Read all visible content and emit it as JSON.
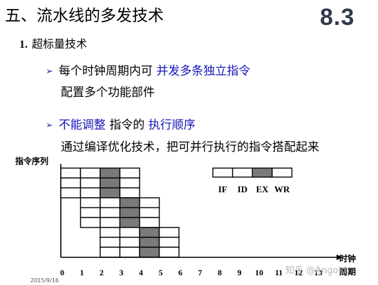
{
  "slide": {
    "title": "五、流水线的多发技术",
    "badge": "8.3",
    "section_num": "1.",
    "section_label": "超标量技术",
    "bullet_marker": "➢",
    "bullet1_prefix": "每个时钟周期内可",
    "bullet1_highlight": "并发多条独立指令",
    "bullet1_sub": "配置多个功能部件",
    "bullet2_highlight1": "不能调整",
    "bullet2_middle": "指令的",
    "bullet2_highlight2": "执行顺序",
    "bullet2_sub": "通过编译优化技术，把可并行执行的指令搭配起来",
    "date": "2015/9/16",
    "watermark": "知乎 @Angold",
    "highlight_color": "#1515b8"
  },
  "diagram": {
    "y_axis_label": "指令序列",
    "x_axis_label_line1": "时钟",
    "x_axis_label_line2": "周期",
    "x_ticks": [
      "0",
      "1",
      "2",
      "3",
      "4",
      "5",
      "6",
      "7",
      "8",
      "9",
      "10",
      "11",
      "12",
      "13"
    ],
    "legend_stages": [
      "IF",
      "ID",
      "EX",
      "WR"
    ],
    "legend_highlight_stage": "EX",
    "instruction_groups": [
      {
        "start_cycle": 0,
        "count": 3
      },
      {
        "start_cycle": 1,
        "count": 3
      },
      {
        "start_cycle": 2,
        "count": 3
      }
    ],
    "stage_fill": "#7a7a7a"
  }
}
